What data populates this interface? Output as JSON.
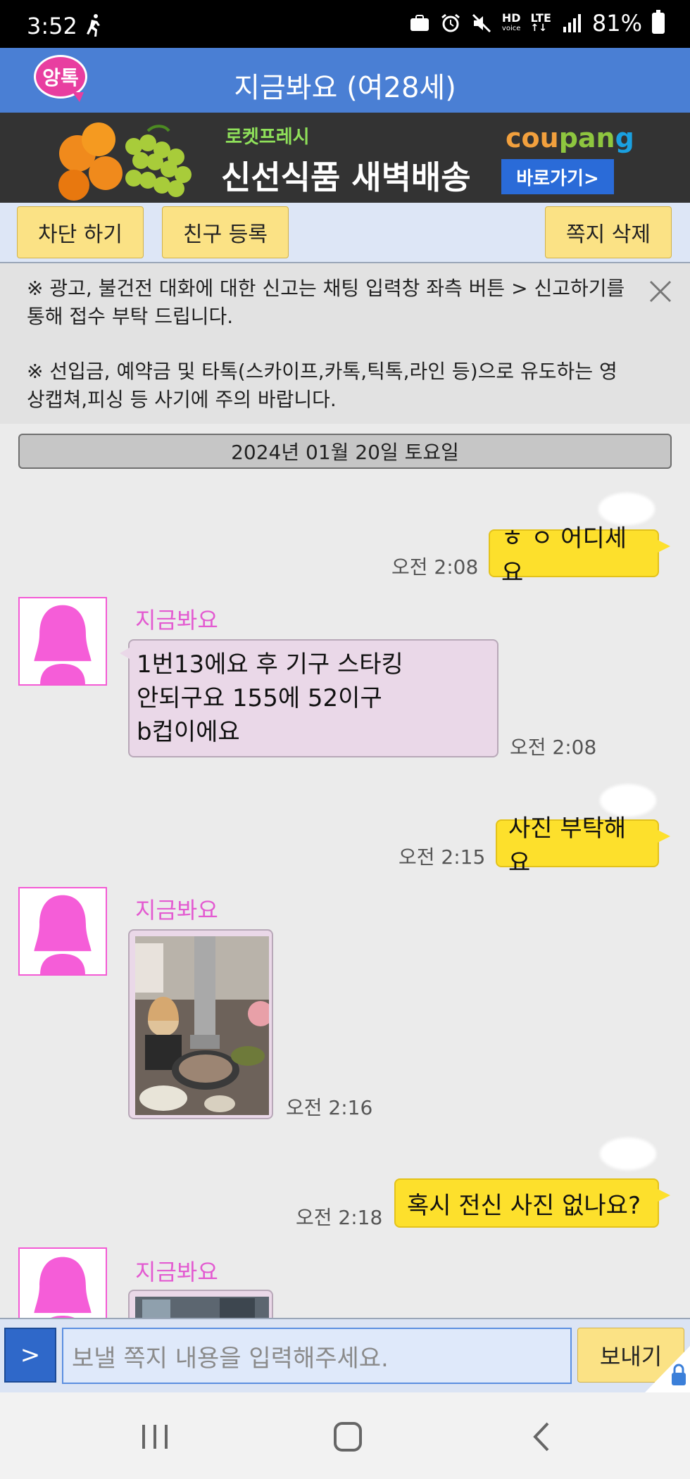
{
  "status_bar": {
    "time": "3:52",
    "hd_label": "HD",
    "hd_sub": "voice",
    "lte_label": "LTE",
    "battery_text": "81%"
  },
  "header": {
    "logo_text": "앙톡",
    "title": "지금봐요 (여28세)"
  },
  "ad": {
    "tag": "로켓프레시",
    "headline": "신선식품 새벽배송",
    "brand_part1": "cou",
    "brand_part2": "pan",
    "brand_part3": "g",
    "button": "바로가기>"
  },
  "actions": {
    "block": "차단 하기",
    "add_friend": "친구 등록",
    "delete_note": "쪽지 삭제"
  },
  "notice": {
    "line1": "※ 광고, 불건전 대화에 대한 신고는 채팅 입력창 좌측 버튼 > 신고하기를 통해 접수 부탁 드립니다.",
    "line2": "※ 선입금, 예약금 및 타톡(스카이프,카톡,틱톡,라인 등)으로 유도하는 영상캡쳐,피싱 등 사기에 주의 바랍니다."
  },
  "chat": {
    "date": "2024년 01월 20일 토요일",
    "sender_name": "지금봐요",
    "messages": [
      {
        "dir": "out",
        "text": "ㅎ ㅇ 어디세요",
        "time": "오전 2:08"
      },
      {
        "dir": "in",
        "lines": [
          "1번13에요 후 기구 스타킹",
          "안되구요 155에 52이구",
          "b컵이에요"
        ],
        "time": "오전 2:08"
      },
      {
        "dir": "out",
        "text": "사진 부탁해요",
        "time": "오전 2:15"
      },
      {
        "dir": "in",
        "type": "photo",
        "time": "오전 2:16"
      },
      {
        "dir": "out",
        "text": "혹시 전신 사진 없나요?",
        "time": "오전 2:18"
      },
      {
        "dir": "in",
        "type": "photo"
      }
    ]
  },
  "input": {
    "expand_label": ">",
    "placeholder": "보낼 쪽지 내용을 입력해주세요.",
    "send": "보내기"
  },
  "colors": {
    "header": "#4a7fd4",
    "bubble_out": "#fde02c",
    "bubble_in": "#ead8e8",
    "sender_name": "#e35bd1",
    "action_button": "#fbe285"
  },
  "icons": [
    "running-figure-icon",
    "briefcase-icon",
    "alarm-icon",
    "mute-icon",
    "signal-icon",
    "battery-icon",
    "close-icon",
    "lock-icon",
    "recent-apps-icon",
    "home-icon",
    "back-icon"
  ]
}
